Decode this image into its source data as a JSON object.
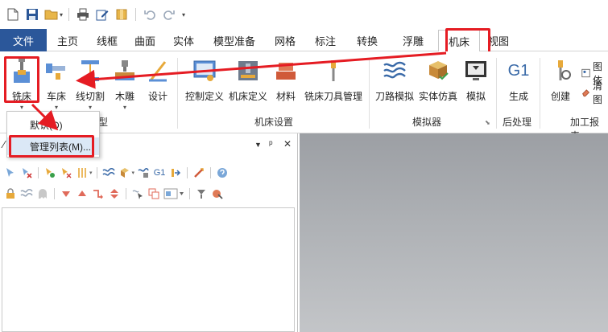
{
  "tabs": {
    "file": "文件",
    "items": [
      "主页",
      "线框",
      "曲面",
      "实体",
      "模型准备",
      "网格",
      "标注",
      "转换",
      "浮雕",
      "机床",
      "视图"
    ],
    "active": "机床"
  },
  "ribbon": {
    "machine_type": {
      "group_label": "型",
      "mill": "铣床",
      "lathe": "车床",
      "wire": "线切割",
      "router": "木雕",
      "design": "设计"
    },
    "machine_setup": {
      "group_label": "机床设置",
      "control_def": "控制定义",
      "machine_def": "机床定义",
      "material": "材料",
      "tool_manager": "铣床刀具管理"
    },
    "simulator": {
      "group_label": "模拟器",
      "toolpath_sim": "刀路模拟",
      "solid_sim": "实体仿真",
      "simulate": "模拟"
    },
    "post": {
      "group_label": "后处理",
      "g1_glyph": "G1",
      "generate": "生成"
    },
    "reports": {
      "group_label": "加工报表",
      "create": "创建",
      "image_label": "图依",
      "clear_label": "清图"
    }
  },
  "dropdown": {
    "default": "默认(D)",
    "manage_list": "管理列表(M)..."
  },
  "panel": {
    "pin_glyph": "ᵖ",
    "close_glyph": "✕",
    "g1_glyph": "G1"
  },
  "colors": {
    "file_tab": "#2b579a",
    "highlight": "#e51c23",
    "selected": "#d5e5f5"
  }
}
